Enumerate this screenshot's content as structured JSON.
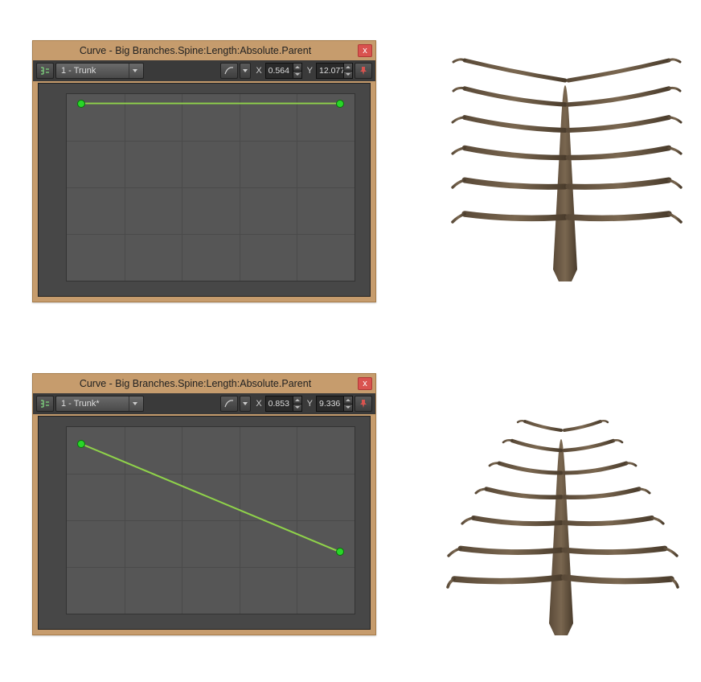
{
  "panels": [
    {
      "title": "Curve - Big Branches.Spine:Length:Absolute.Parent",
      "close_label": "x",
      "dropdown": "1 - Trunk",
      "x_label": "X",
      "y_label": "Y",
      "x_value": "0.564",
      "y_value": "12.077",
      "curve": {
        "p1": {
          "x": 0.05,
          "y": 0.05
        },
        "p2": {
          "x": 0.95,
          "y": 0.05
        }
      }
    },
    {
      "title": "Curve - Big Branches.Spine:Length:Absolute.Parent",
      "close_label": "x",
      "dropdown": "1 - Trunk*",
      "x_label": "X",
      "y_label": "Y",
      "x_value": "0.853",
      "y_value": "9.336",
      "curve": {
        "p1": {
          "x": 0.05,
          "y": 0.09
        },
        "p2": {
          "x": 0.95,
          "y": 0.67
        }
      }
    }
  ]
}
